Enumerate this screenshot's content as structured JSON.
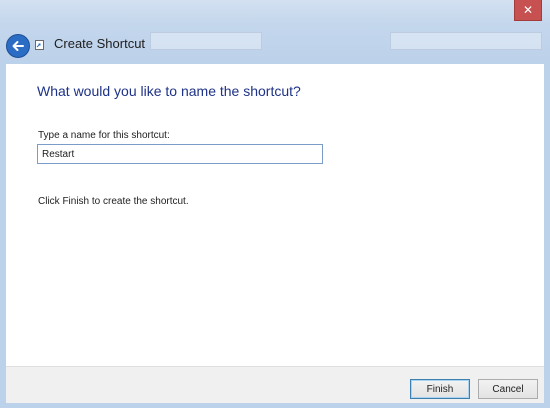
{
  "window": {
    "title": "Create Shortcut",
    "close_glyph": "✕",
    "accent": "#2b6cc4",
    "close_color": "#c75050"
  },
  "icons": {
    "back": "back-arrow-icon",
    "title": "shortcut-icon",
    "close": "close-icon"
  },
  "main": {
    "heading": "What would you like to name the shortcut?",
    "name_label": "Type a name for this shortcut:",
    "name_value": "Restart",
    "instruction": "Click Finish to create the shortcut."
  },
  "footer": {
    "finish_label": "Finish",
    "cancel_label": "Cancel"
  }
}
